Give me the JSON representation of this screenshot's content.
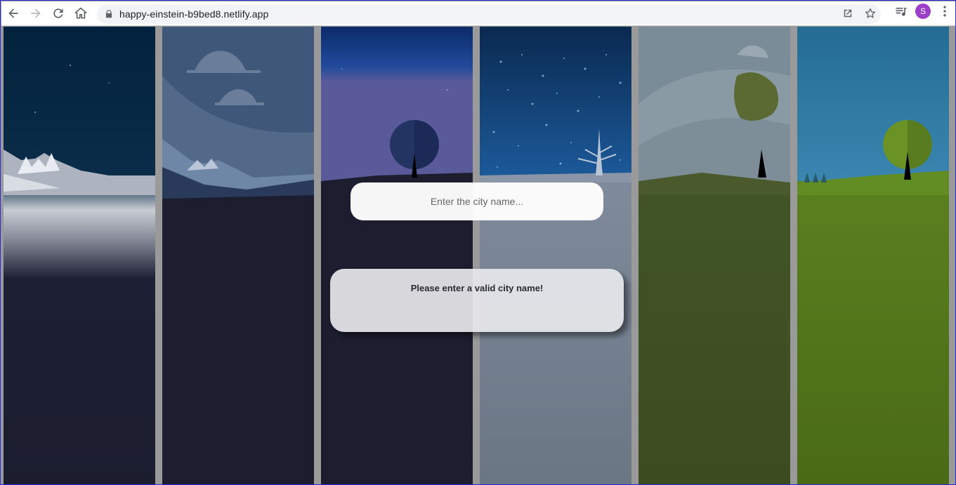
{
  "browser": {
    "url": "happy-einstein-b9bed8.netlify.app",
    "profile_initial": "S",
    "icons": [
      "back-arrow-icon",
      "forward-arrow-icon",
      "reload-icon",
      "home-icon",
      "lock-icon",
      "open-in-new-icon",
      "star-icon",
      "media-control-icon",
      "kebab-menu-icon"
    ]
  },
  "search": {
    "placeholder": "Enter the city name...",
    "value": ""
  },
  "result": {
    "message": "Please enter a valid city name!"
  },
  "colors": {
    "page_gap": "#9a9a9a",
    "ground_dark": "#1c1e30",
    "grass_green": "#5c7c22",
    "profile_purple": "#9b3ec8"
  }
}
